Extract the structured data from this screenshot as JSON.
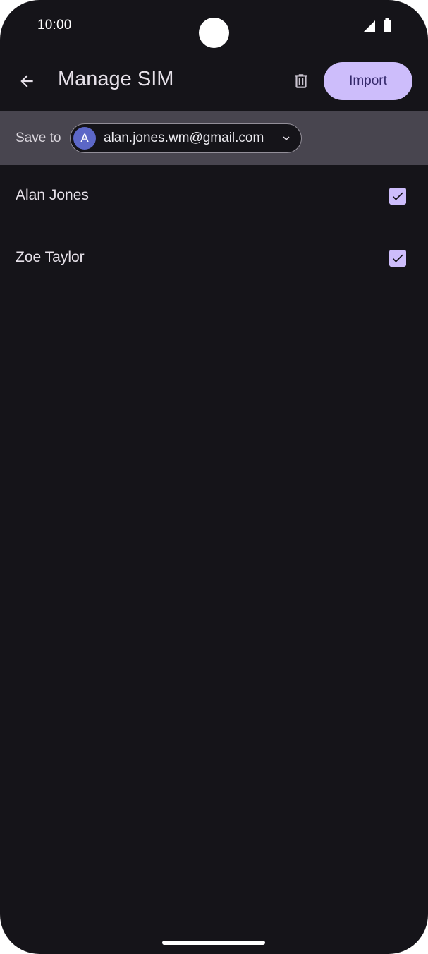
{
  "status_bar": {
    "time": "10:00",
    "icons": [
      "signal-icon",
      "battery-icon"
    ]
  },
  "app_bar": {
    "back_icon": "arrow-back-icon",
    "title": "Manage SIM",
    "delete_icon": "trash-icon",
    "import_label": "Import"
  },
  "save_to": {
    "label": "Save to",
    "account_initial": "A",
    "account_email": "alan.jones.wm@gmail.com",
    "dropdown_icon": "chevron-down-icon"
  },
  "contacts": [
    {
      "name": "Alan Jones",
      "checked": true
    },
    {
      "name": "Zoe Taylor",
      "checked": true
    }
  ],
  "colors": {
    "background": "#151419",
    "accent": "#cdbdfb",
    "accent_text": "#34286b",
    "save_bar": "#48454f",
    "avatar": "#5c67c7"
  }
}
